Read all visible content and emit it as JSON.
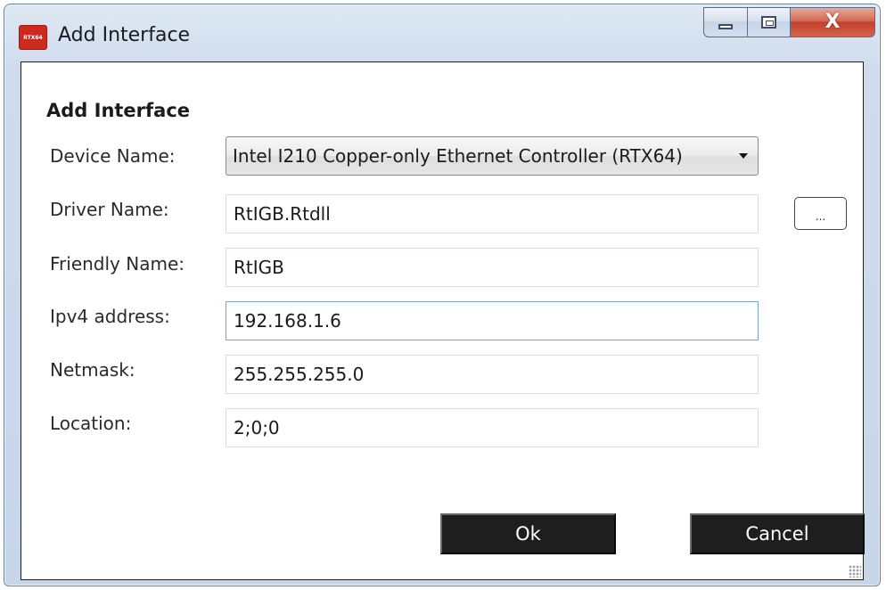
{
  "window": {
    "title": "Add Interface",
    "app_icon_text": "RTX64",
    "icons": {
      "app": "rtx64-app-icon",
      "minimize": "minimize-icon",
      "maximize": "maximize-icon",
      "close": "close-icon"
    },
    "close_glyph": "X"
  },
  "form": {
    "heading": "Add Interface",
    "device_name": {
      "label": "Device Name:",
      "selected": "Intel I210 Copper-only Ethernet Controller (RTX64)"
    },
    "driver_name": {
      "label": "Driver Name:",
      "value": "RtIGB.Rtdll",
      "browse_label": "..."
    },
    "friendly_name": {
      "label": "Friendly Name:",
      "value": "RtIGB"
    },
    "ipv4_address": {
      "label": "Ipv4 address:",
      "value": "192.168.1.6"
    },
    "netmask": {
      "label": "Netmask:",
      "value": "255.255.255.0"
    },
    "location": {
      "label": "Location:",
      "value": "2;0;0"
    }
  },
  "buttons": {
    "ok": "Ok",
    "cancel": "Cancel"
  },
  "colors": {
    "button_dark": "#1e1e1e",
    "app_icon": "#cc2a1e",
    "close_button": "#c4402a",
    "focus_border": "#7aa7d8"
  }
}
